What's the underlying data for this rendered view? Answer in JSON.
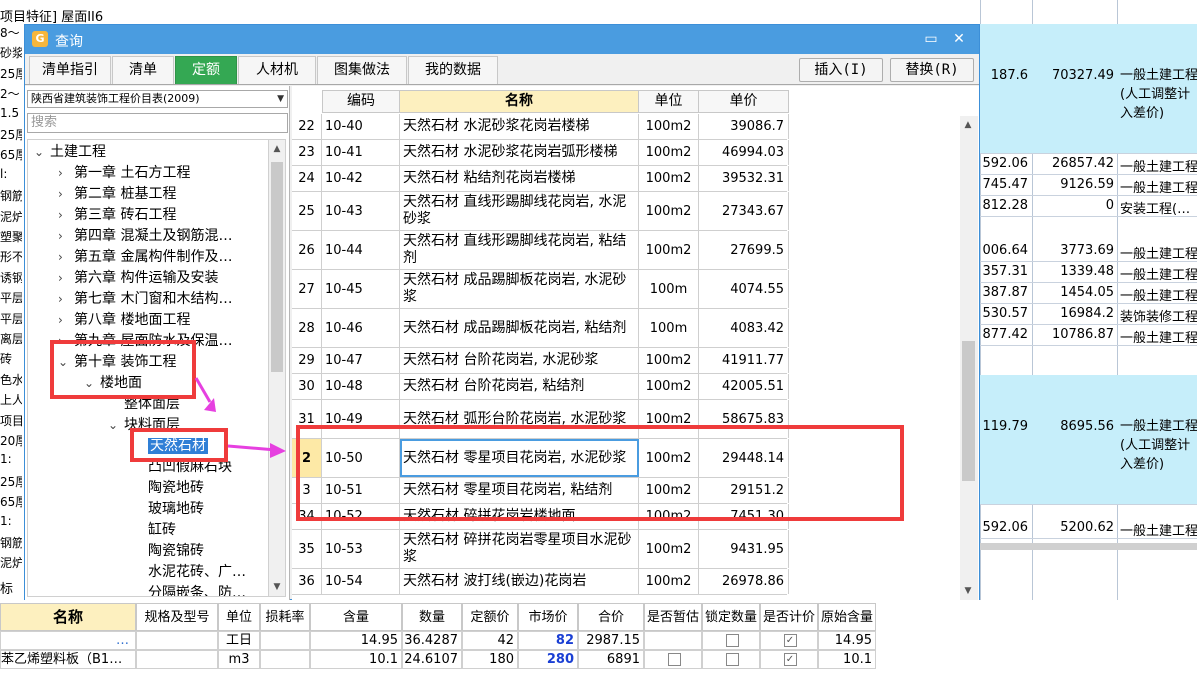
{
  "background": {
    "top_text": "项目特征] 屋面II6",
    "left_fragments": [
      "8～",
      "砂浆",
      "25厚",
      "2～",
      "1.5",
      "25厚",
      "65厚",
      "l:",
      "钢筋",
      "泥炉",
      "塑聚",
      "形不",
      "诱钢",
      "平层",
      "平层",
      "离层",
      "砖",
      "色水",
      "上人",
      "项目",
      "20厚",
      "1:",
      "25厚",
      "65厚",
      "1:",
      "钢筋",
      "泥炉"
    ],
    "right_rows": [
      {
        "a": "187.6",
        "b": "70327.49",
        "c": "一般土建工程(人工调整计入差价)",
        "blue": true
      },
      {
        "a": "592.06",
        "b": "26857.42",
        "c": "一般土建工程",
        "blue": false
      },
      {
        "a": "745.47",
        "b": "9126.59",
        "c": "一般土建工程",
        "blue": false
      },
      {
        "a": "812.28",
        "b": "0",
        "c": "安装工程(…",
        "blue": false
      },
      {
        "a": "006.64",
        "b": "3773.69",
        "c": "一般土建工程",
        "blue": false
      },
      {
        "a": "357.31",
        "b": "1339.48",
        "c": "一般土建工程",
        "blue": false
      },
      {
        "a": "387.87",
        "b": "1454.05",
        "c": "一般土建工程",
        "blue": false
      },
      {
        "a": "530.57",
        "b": "16984.2",
        "c": "装饰装修工程",
        "blue": false
      },
      {
        "a": "877.42",
        "b": "10786.87",
        "c": "一般土建工程",
        "blue": false
      },
      {
        "a": "119.79",
        "b": "8695.56",
        "c": "一般土建工程(人工调整计入差价)",
        "blue": true
      },
      {
        "a": "592.06",
        "b": "5200.62",
        "c": "一般土建工程",
        "blue": false
      }
    ]
  },
  "dialog": {
    "title": "查询",
    "tabs": [
      "清单指引",
      "清单",
      "定额",
      "人材机",
      "图集做法",
      "我的数据"
    ],
    "active_tab": "定额",
    "insert_label": "插入(I)",
    "replace_label": "替换(R)",
    "library_select": "陕西省建筑装饰工程价目表(2009)",
    "search_placeholder": "搜索",
    "tree": [
      {
        "label": "土建工程",
        "level": 0,
        "exp": "⌄"
      },
      {
        "label": "第一章  土石方工程",
        "level": 1,
        "exp": "›"
      },
      {
        "label": "第二章  桩基工程",
        "level": 1,
        "exp": "›"
      },
      {
        "label": "第三章  砖石工程",
        "level": 1,
        "exp": "›"
      },
      {
        "label": "第四章  混凝土及钢筋混…",
        "level": 1,
        "exp": "›"
      },
      {
        "label": "第五章  金属构件制作及…",
        "level": 1,
        "exp": "›"
      },
      {
        "label": "第六章  构件运输及安装",
        "level": 1,
        "exp": "›"
      },
      {
        "label": "第七章  木门窗和木结构…",
        "level": 1,
        "exp": "›"
      },
      {
        "label": "第八章  楼地面工程",
        "level": 1,
        "exp": "›"
      },
      {
        "label": "第九章  屋面防水及保温…",
        "level": 1,
        "exp": "›"
      },
      {
        "label": "第十章  装饰工程",
        "level": 1,
        "exp": "⌄"
      },
      {
        "label": "楼地面",
        "level": 2,
        "exp": "⌄"
      },
      {
        "label": "整体面层",
        "level": 3,
        "exp": ""
      },
      {
        "label": "块料面层",
        "level": 3,
        "exp": "⌄"
      },
      {
        "label": "天然石材",
        "level": 4,
        "exp": "",
        "selected": true
      },
      {
        "label": "凸凹假麻石块",
        "level": 4,
        "exp": ""
      },
      {
        "label": "陶瓷地砖",
        "level": 4,
        "exp": ""
      },
      {
        "label": "玻璃地砖",
        "level": 4,
        "exp": ""
      },
      {
        "label": "缸砖",
        "level": 4,
        "exp": ""
      },
      {
        "label": "陶瓷锦砖",
        "level": 4,
        "exp": ""
      },
      {
        "label": "水泥花砖、广…",
        "level": 4,
        "exp": ""
      },
      {
        "label": "分隔嵌条、防…",
        "level": 4,
        "exp": ""
      }
    ],
    "grid": {
      "headers": {
        "code": "编码",
        "name": "名称",
        "unit": "单位",
        "price": "单价"
      },
      "rows": [
        {
          "rn": "22",
          "code": "10-40",
          "name": "天然石材  水泥砂浆花岗岩楼梯",
          "unit": "100m2",
          "price": "39086.7",
          "h": 26
        },
        {
          "rn": "23",
          "code": "10-41",
          "name": "天然石材  水泥砂浆花岗岩弧形楼梯",
          "unit": "100m2",
          "price": "46994.03",
          "h": 26
        },
        {
          "rn": "24",
          "code": "10-42",
          "name": "天然石材  粘结剂花岗岩楼梯",
          "unit": "100m2",
          "price": "39532.31",
          "h": 26
        },
        {
          "rn": "25",
          "code": "10-43",
          "name": "天然石材  直线形踢脚线花岗岩, 水泥砂浆",
          "unit": "100m2",
          "price": "27343.67",
          "h": 39
        },
        {
          "rn": "26",
          "code": "10-44",
          "name": "天然石材  直线形踢脚线花岗岩, 粘结剂",
          "unit": "100m2",
          "price": "27699.5",
          "h": 39
        },
        {
          "rn": "27",
          "code": "10-45",
          "name": "天然石材  成品踢脚板花岗岩, 水泥砂浆",
          "unit": "100m",
          "price": "4074.55",
          "h": 39
        },
        {
          "rn": "28",
          "code": "10-46",
          "name": "天然石材  成品踢脚板花岗岩, 粘结剂",
          "unit": "100m",
          "price": "4083.42",
          "h": 39
        },
        {
          "rn": "29",
          "code": "10-47",
          "name": "天然石材  台阶花岗岩, 水泥砂浆",
          "unit": "100m2",
          "price": "41911.77",
          "h": 26
        },
        {
          "rn": "30",
          "code": "10-48",
          "name": "天然石材  台阶花岗岩, 粘结剂",
          "unit": "100m2",
          "price": "42005.51",
          "h": 26
        },
        {
          "rn": "31",
          "code": "10-49",
          "name": "天然石材  弧形台阶花岗岩, 水泥砂浆",
          "unit": "100m2",
          "price": "58675.83",
          "h": 39
        },
        {
          "rn": "2",
          "code": "10-50",
          "name": "天然石材  零星项目花岗岩, 水泥砂浆",
          "unit": "100m2",
          "price": "29448.14",
          "h": 39,
          "current": true
        },
        {
          "rn": "3",
          "code": "10-51",
          "name": "天然石材  零星项目花岗岩, 粘结剂",
          "unit": "100m2",
          "price": "29151.2",
          "h": 26
        },
        {
          "rn": "34",
          "code": "10-52",
          "name": "天然石材  碎拼花岗岩楼地面",
          "unit": "100m2",
          "price": "7451.30",
          "h": 26
        },
        {
          "rn": "35",
          "code": "10-53",
          "name": "天然石材  碎拼花岗岩零星项目水泥砂浆",
          "unit": "100m2",
          "price": "9431.95",
          "h": 39
        },
        {
          "rn": "36",
          "code": "10-54",
          "name": "天然石材  波打线(嵌边)花岗岩",
          "unit": "100m2",
          "price": "26978.86",
          "h": 26
        }
      ]
    }
  },
  "materials": {
    "side_label": "标",
    "headers": [
      "名称",
      "规格及型号",
      "单位",
      "损耗率",
      "含量",
      "数量",
      "定额价",
      "市场价",
      "合价",
      "是否暂估",
      "锁定数量",
      "是否计价",
      "原始含量"
    ],
    "rows": [
      {
        "name": "…",
        "spec": "",
        "unit": "工日",
        "loss": "",
        "content": "14.95",
        "qty": "36.4287",
        "quota": "42",
        "market": "82",
        "total": "2987.15",
        "est": "",
        "lock": "",
        "priced": "✓",
        "orig": "14.95"
      },
      {
        "name": "苯乙烯塑料板（B1…",
        "spec": "",
        "unit": "m3",
        "loss": "",
        "content": "10.1",
        "qty": "24.6107",
        "quota": "180",
        "market": "280",
        "total": "6891",
        "est": "",
        "lock": "",
        "priced": "✓",
        "orig": "10.1"
      }
    ]
  }
}
